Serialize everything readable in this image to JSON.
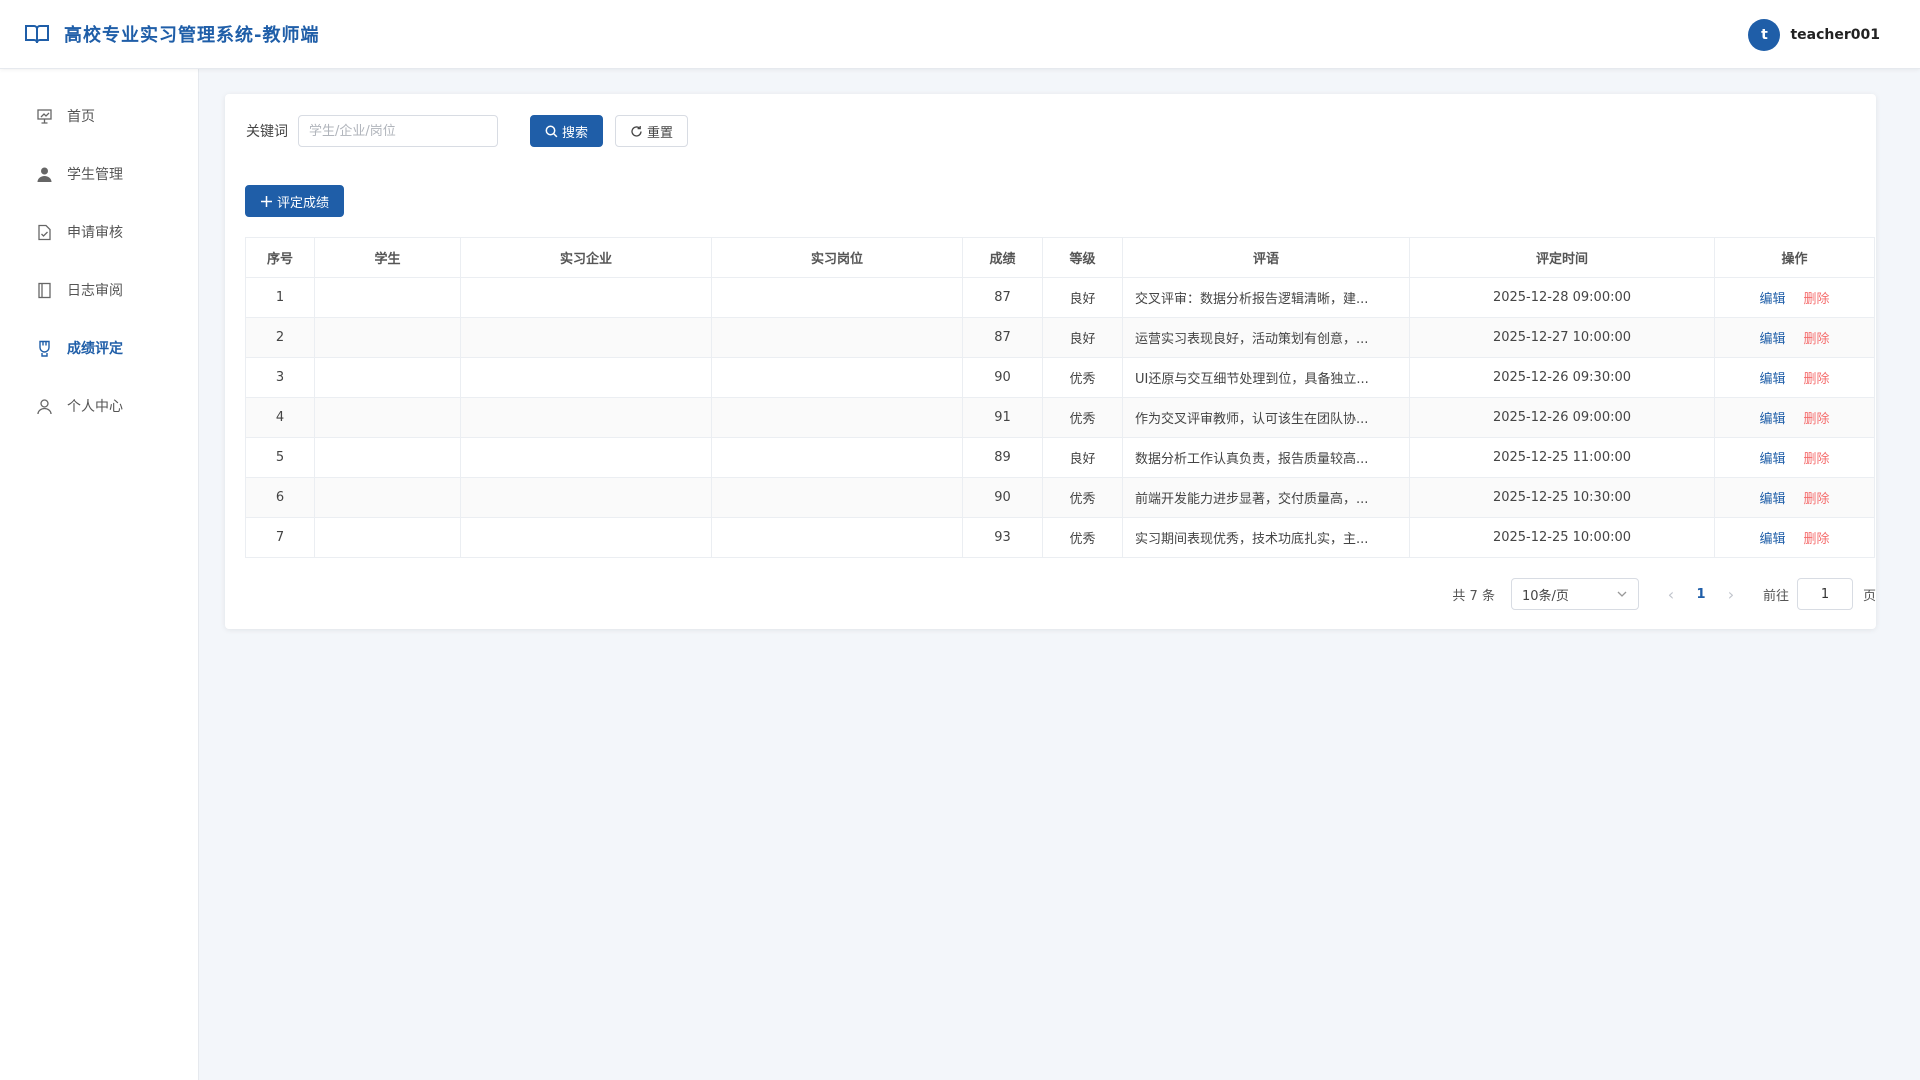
{
  "header": {
    "title": "高校专业实习管理系统-教师端",
    "avatar_letter": "t",
    "username": "teacher001"
  },
  "sidebar": {
    "items": [
      {
        "label": "首页",
        "icon": "presentation-icon",
        "active": false
      },
      {
        "label": "学生管理",
        "icon": "user-icon",
        "active": false
      },
      {
        "label": "申请审核",
        "icon": "document-check-icon",
        "active": false
      },
      {
        "label": "日志审阅",
        "icon": "notebook-icon",
        "active": false
      },
      {
        "label": "成绩评定",
        "icon": "medal-icon",
        "active": true
      },
      {
        "label": "个人中心",
        "icon": "user-outline-icon",
        "active": false
      }
    ]
  },
  "search": {
    "label": "关键词",
    "placeholder": "学生/企业/岗位",
    "value": "",
    "search_label": "搜索",
    "reset_label": "重置"
  },
  "toolbar": {
    "add_label": "评定成绩"
  },
  "table": {
    "columns": [
      "序号",
      "学生",
      "实习企业",
      "实习岗位",
      "成绩",
      "等级",
      "评语",
      "评定时间",
      "操作"
    ],
    "edit_label": "编辑",
    "delete_label": "删除",
    "rows": [
      {
        "no": "1",
        "student": "",
        "company": "",
        "position": "",
        "score": "87",
        "level": "良好",
        "comment": "交叉评审：数据分析报告逻辑清晰，建...",
        "time": "2025-12-28 09:00:00"
      },
      {
        "no": "2",
        "student": "",
        "company": "",
        "position": "",
        "score": "87",
        "level": "良好",
        "comment": "运营实习表现良好，活动策划有创意，...",
        "time": "2025-12-27 10:00:00"
      },
      {
        "no": "3",
        "student": "",
        "company": "",
        "position": "",
        "score": "90",
        "level": "优秀",
        "comment": "UI还原与交互细节处理到位，具备独立...",
        "time": "2025-12-26 09:30:00"
      },
      {
        "no": "4",
        "student": "",
        "company": "",
        "position": "",
        "score": "91",
        "level": "优秀",
        "comment": "作为交叉评审教师，认可该生在团队协...",
        "time": "2025-12-26 09:00:00"
      },
      {
        "no": "5",
        "student": "",
        "company": "",
        "position": "",
        "score": "89",
        "level": "良好",
        "comment": "数据分析工作认真负责，报告质量较高...",
        "time": "2025-12-25 11:00:00"
      },
      {
        "no": "6",
        "student": "",
        "company": "",
        "position": "",
        "score": "90",
        "level": "优秀",
        "comment": "前端开发能力进步显著，交付质量高，...",
        "time": "2025-12-25 10:30:00"
      },
      {
        "no": "7",
        "student": "",
        "company": "",
        "position": "",
        "score": "93",
        "level": "优秀",
        "comment": "实习期间表现优秀，技术功底扎实，主...",
        "time": "2025-12-25 10:00:00"
      }
    ]
  },
  "pagination": {
    "total_text": "共 7 条",
    "page_size": "10条/页",
    "current_page": "1",
    "goto_label": "前往",
    "goto_value": "1",
    "goto_suffix": "页"
  }
}
